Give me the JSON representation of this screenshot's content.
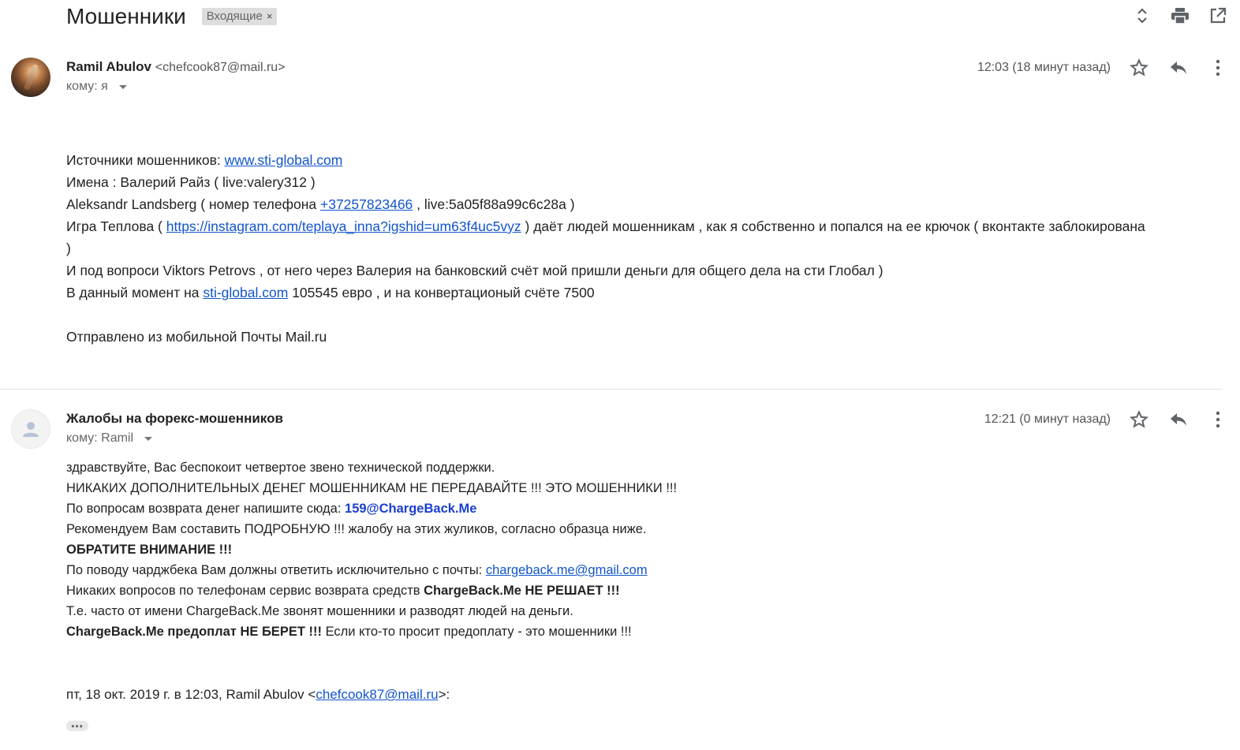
{
  "subject": "Мошенники",
  "label_chip": {
    "text": "Входящие",
    "close": "×"
  },
  "top_actions": [
    {
      "name": "expand-collapse-icon"
    },
    {
      "name": "print-icon"
    },
    {
      "name": "open-new-window-icon"
    }
  ],
  "message1": {
    "sender_name": "Ramil Abulov",
    "sender_email": "<chefcook87@mail.ru>",
    "to_label": "кому: я",
    "time": "12:03 (18 минут назад)",
    "body": {
      "l1_text": "Источники мошенников: ",
      "l1_link": "www.sti-global.com",
      "l2": "Имена : Валерий Райз ( live:valery312 )",
      "l3_a": "Aleksandr Landsberg ( номер телефона ",
      "l3_link": "+37257823466",
      "l3_b": " , live:5a05f88a99c6c28a )",
      "l4_a": "Игра Теплова ( ",
      "l4_link": "https://instagram.com/teplaya_inna?igshid=um63f4uc5vyz",
      "l4_b": " ) даёт людей мошенникам , как я собственно и попался на ее крючок  ( вконтакте заблокирована )",
      "l5": "И под вопроси Viktors Petrovs , от него через Валерия на банковский счёт мой пришли деньги для общего дела на сти Глобал )",
      "l6_a": "В данный момент на ",
      "l6_link": "sti-global.com",
      "l6_b": " 105545 евро , и на конвертационый счёте 7500",
      "signature": "Отправлено из мобильной Почты Mail.ru"
    }
  },
  "message2": {
    "sender_name": "Жалобы на форекс-мошенников",
    "to_label": "кому: Ramil",
    "time": "12:21 (0 минут назад)",
    "body": {
      "l1": "здравствуйте, Вас беспокоит четвертое звено технической поддержки.",
      "l2": "НИКАКИХ ДОПОЛНИТЕЛЬНЫХ ДЕНЕГ МОШЕННИКАМ НЕ ПЕРЕДАВАЙТЕ !!! ЭТО МОШЕННИКИ !!!",
      "l3_a": "По вопросам возврата денег напишите сюда: ",
      "l3_link": "159@ChargeBack.Me",
      "l4": "Рекомендуем Вам составить ПОДРОБНУЮ !!! жалобу на этих жуликов, согласно образца ниже.",
      "l5": "ОБРАТИТЕ ВНИМАНИЕ !!!",
      "l6_a": "По поводу чарджбека Вам должны ответить исключительно с почты: ",
      "l6_link": "chargeback.me@gmail.com",
      "l7_a": "Никаких вопросов по телефонам сервис возврата средств ",
      "l7_b": "ChargeBack.Me НЕ РЕШАЕТ !!!",
      "l8": "Т.е. часто от имени ChargeBack.Me звонят мошенники и разводят людей на деньги.",
      "l9_a": "ChargeBack.Me предоплат НЕ БЕРЕТ !!!",
      "l9_b": " Если кто-то просит предоплату - это мошенники !!!"
    },
    "quote_a": "пт, 18 окт. 2019 г. в 12:03, Ramil Abulov <",
    "quote_link": "chefcook87@mail.ru",
    "quote_b": ">:",
    "more_label": "•••"
  },
  "colors": {
    "link": "#1155cc",
    "bold_link": "#1a3fd1",
    "chip_bg": "#dddddd",
    "icon": "#5f6368"
  }
}
